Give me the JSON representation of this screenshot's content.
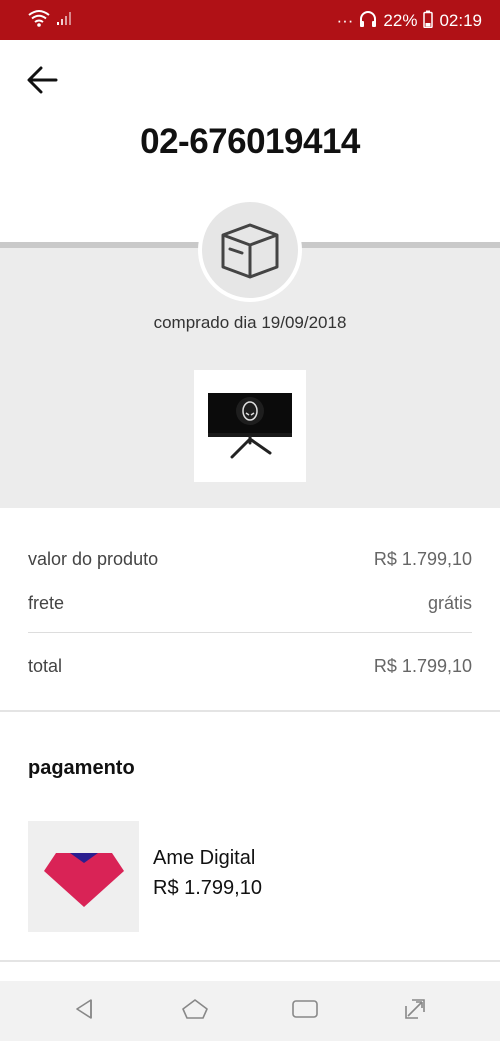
{
  "status_bar": {
    "dots": "···",
    "battery": "22%",
    "time": "02:19"
  },
  "order": {
    "id": "02-676019414",
    "purchase_date": "comprado dia 19/09/2018"
  },
  "summary": {
    "product_label": "valor do produto",
    "product_value": "R$ 1.799,10",
    "shipping_label": "frete",
    "shipping_value": "grátis",
    "total_label": "total",
    "total_value": "R$ 1.799,10"
  },
  "payment": {
    "title": "pagamento",
    "method_name": "Ame Digital",
    "amount": "R$ 1.799,10"
  },
  "colors": {
    "status_bar": "#b01116",
    "ame_pink": "#d92356",
    "ame_blue": "#2b1e8f"
  },
  "icons": {
    "back": "arrow-left-icon",
    "box": "package-icon",
    "nav": [
      "back-triangle-icon",
      "home-icon",
      "recents-icon",
      "expand-icon"
    ]
  }
}
